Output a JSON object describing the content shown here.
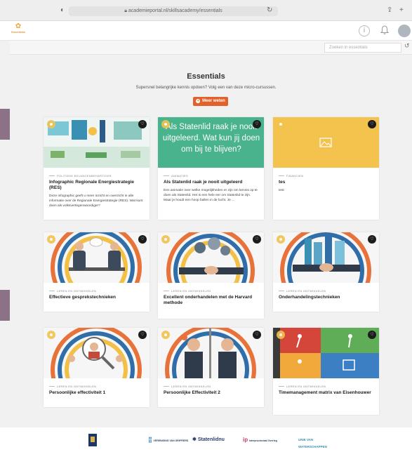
{
  "browser": {
    "url": "academieportal.nl/skillsacademy/essentials"
  },
  "header": {
    "logo_text": "Essentials"
  },
  "toolbar": {
    "search_placeholder": "Zoeken in essentials"
  },
  "page": {
    "title": "Essentials",
    "lead": "Supersnel belangrijke kennis opdoen? Volg een van deze micro-cursussen.",
    "more_button": "Meer weten"
  },
  "cards": [
    {
      "category": "POLITIEKE BELANGENBEHARTIGER",
      "title": "Infographic Regionale Energiestrategie (RES)",
      "description": "Deze infographic geeft u meer inzicht en overzicht in alle informatie over de Regionale Energiestrategie (RES). Wat kunt doen als volksvertegenwoordiger?"
    },
    {
      "category": "ANIMATIES",
      "title": "Als Statenlid raak je nooit uitgeleerd",
      "description": "Een animatie over welke mogelijkheden er zijn om kennis op te doen als Statenlid. Het is een hele eer om Statenlid te zijn. Maar je houdt een hoop ballen in de lucht. Je ...",
      "thumb_text": "Als Statenlid raak je nooit uitgeleerd. Wat kun jij doen om bij te blijven?"
    },
    {
      "category": "FINANCIEN",
      "title": "tes",
      "description": "test"
    },
    {
      "category": "LEREN EN ONTWIKKELEN",
      "title": "Effectieve gesprekstechnieken",
      "description": ""
    },
    {
      "category": "LEREN EN ONTWIKKELEN",
      "title": "Excellent onderhandelen met de Harvard methode",
      "description": ""
    },
    {
      "category": "LEREN EN ONTWIKKELEN",
      "title": "Onderhandelingstechnieken",
      "description": ""
    },
    {
      "category": "LEREN EN ONTWIKKELEN",
      "title": "Persoonlijke effectiviteit 1",
      "description": ""
    },
    {
      "category": "LEREN EN ONTWIKKELEN",
      "title": "Persoonlijke Effectiviteit 2",
      "description": ""
    },
    {
      "category": "LEREN EN ONTWIKKELEN",
      "title": "Timemanagement matrix van Eisenhouwer",
      "description": ""
    }
  ],
  "footer": {
    "logos": [
      "VERENIGING VAN GRIFFIERS",
      "Statenlidnu",
      "Interprovinciaal Overleg",
      "UNIE VAN WATERSCHAPPEN"
    ]
  },
  "colors": {
    "accent": "#e2622b",
    "teal": "#49b38d",
    "yellow": "#f3c34e"
  }
}
